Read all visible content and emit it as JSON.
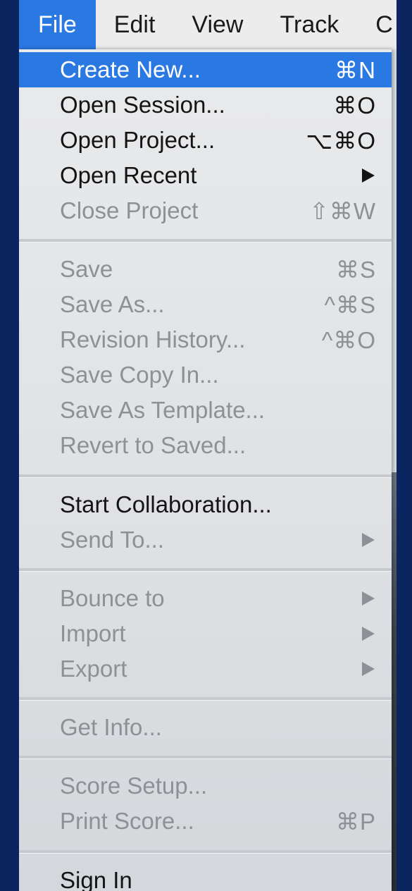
{
  "menubar": {
    "items": [
      {
        "label": "File"
      },
      {
        "label": "Edit"
      },
      {
        "label": "View"
      },
      {
        "label": "Track"
      },
      {
        "label": "C"
      }
    ]
  },
  "menu": {
    "create_new": {
      "label": "Create New...",
      "shortcut": "⌘N"
    },
    "open_session": {
      "label": "Open Session...",
      "shortcut": "⌘O"
    },
    "open_project": {
      "label": "Open Project...",
      "shortcut": "⌥⌘O"
    },
    "open_recent": {
      "label": "Open Recent",
      "icon": "submenu-arrow-icon"
    },
    "close_project": {
      "label": "Close Project",
      "shortcut": "⇧⌘W"
    },
    "save": {
      "label": "Save",
      "shortcut": "⌘S"
    },
    "save_as": {
      "label": "Save As...",
      "shortcut": "^⌘S"
    },
    "revision_history": {
      "label": "Revision History...",
      "shortcut": "^⌘O"
    },
    "save_copy_in": {
      "label": "Save Copy In..."
    },
    "save_as_template": {
      "label": "Save As Template..."
    },
    "revert_to_saved": {
      "label": "Revert to Saved..."
    },
    "start_collaboration": {
      "label": "Start Collaboration..."
    },
    "send_to": {
      "label": "Send To...",
      "icon": "submenu-arrow-icon"
    },
    "bounce_to": {
      "label": "Bounce to",
      "icon": "submenu-arrow-icon"
    },
    "import": {
      "label": "Import",
      "icon": "submenu-arrow-icon"
    },
    "export": {
      "label": "Export",
      "icon": "submenu-arrow-icon"
    },
    "get_info": {
      "label": "Get Info..."
    },
    "score_setup": {
      "label": "Score Setup..."
    },
    "print_score": {
      "label": "Print Score...",
      "shortcut": "⌘P"
    },
    "sign_in": {
      "label": "Sign In"
    }
  },
  "colors": {
    "highlight": "#2a79e3",
    "background": "#0a2560",
    "enabled_text": "#141414",
    "disabled_text": "#8d9196"
  }
}
